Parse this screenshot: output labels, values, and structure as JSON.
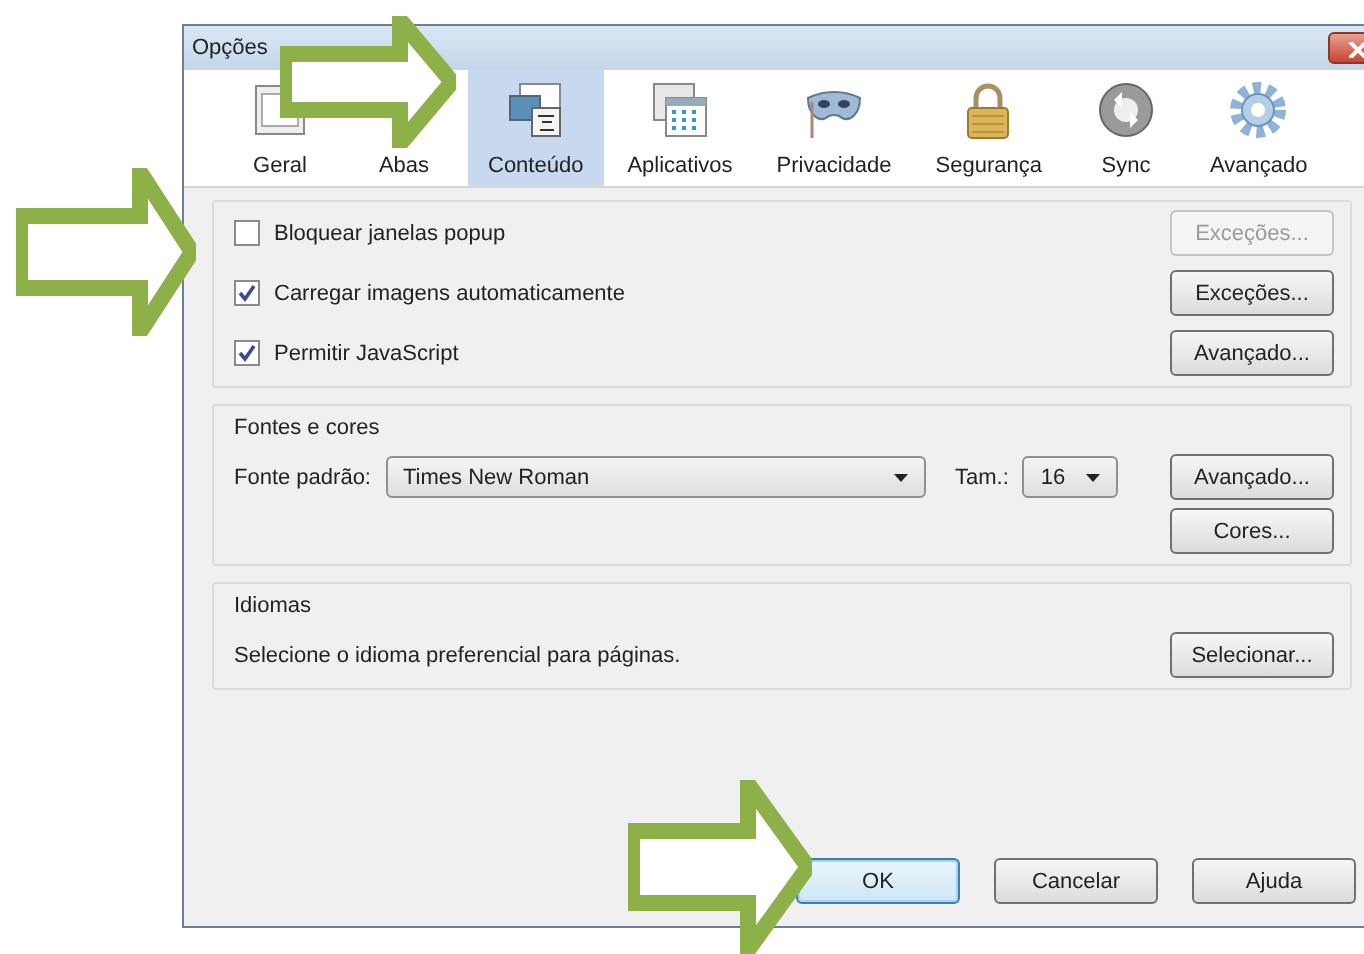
{
  "window": {
    "title": "Opções"
  },
  "tabs": [
    {
      "label": "Geral",
      "kind": "general",
      "selected": false
    },
    {
      "label": "Abas",
      "kind": "tabs",
      "selected": false
    },
    {
      "label": "Conteúdo",
      "kind": "content",
      "selected": true
    },
    {
      "label": "Aplicativos",
      "kind": "apps",
      "selected": false
    },
    {
      "label": "Privacidade",
      "kind": "privacy",
      "selected": false
    },
    {
      "label": "Segurança",
      "kind": "security",
      "selected": false
    },
    {
      "label": "Sync",
      "kind": "sync",
      "selected": false
    },
    {
      "label": "Avançado",
      "kind": "advanced",
      "selected": false
    }
  ],
  "options": [
    {
      "label": "Bloquear janelas popup",
      "checked": false,
      "button": {
        "label": "Exceções...",
        "disabled": true
      }
    },
    {
      "label": "Carregar imagens automaticamente",
      "checked": true,
      "button": {
        "label": "Exceções...",
        "disabled": false
      }
    },
    {
      "label": "Permitir JavaScript",
      "checked": true,
      "button": {
        "label": "Avançado...",
        "disabled": false
      }
    }
  ],
  "fonts": {
    "title": "Fontes e cores",
    "font_label": "Fonte padrão:",
    "font_value": "Times New Roman",
    "size_label": "Tam.:",
    "size_value": "16",
    "buttons": [
      "Avançado...",
      "Cores..."
    ]
  },
  "languages": {
    "title": "Idiomas",
    "text": "Selecione o idioma preferencial para páginas.",
    "button": "Selecionar..."
  },
  "buttons": [
    {
      "label": "OK",
      "default": true
    },
    {
      "label": "Cancelar",
      "default": false
    },
    {
      "label": "Ajuda",
      "default": false
    }
  ]
}
